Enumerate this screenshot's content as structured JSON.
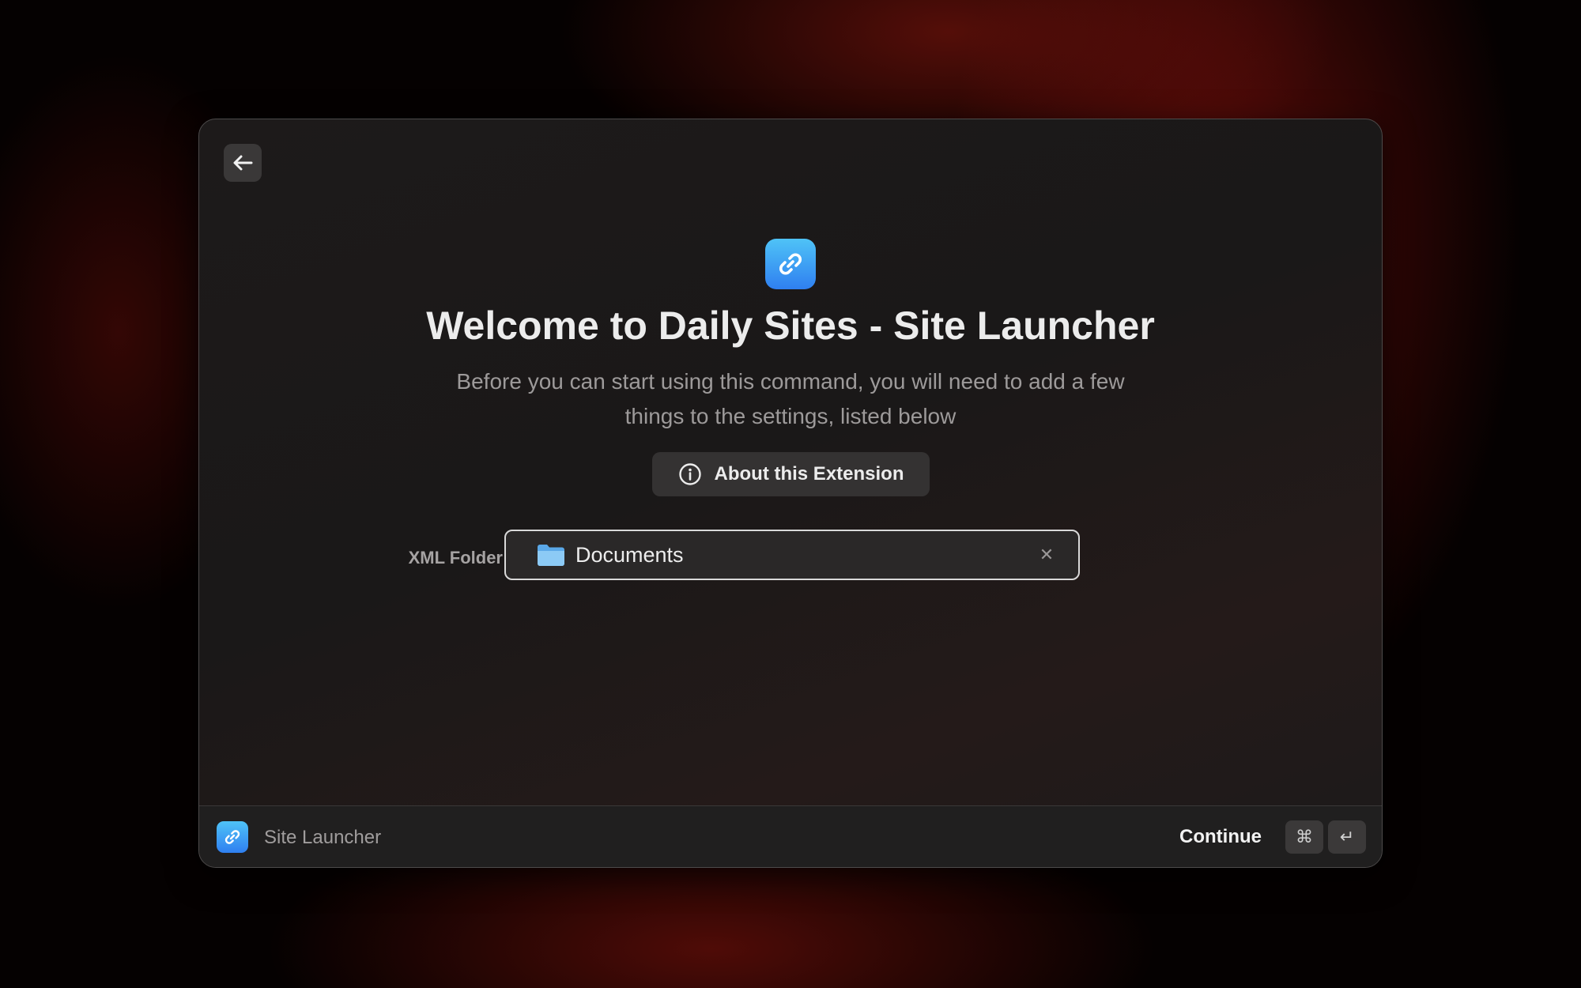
{
  "window": {
    "title": "Welcome to Daily Sites - Site Launcher",
    "subtitle_line1": "Before you can start using this command, you will need to add a few",
    "subtitle_line2": "things to the settings, listed below",
    "app_icon": "link-icon"
  },
  "toolbar": {
    "back_icon": "arrow-left-icon"
  },
  "about_button": {
    "label": "About this Extension",
    "icon": "info-circle-icon"
  },
  "form": {
    "xml_folder_label": "XML Folder",
    "xml_folder_value": "Documents",
    "folder_icon": "folder-icon",
    "clear_icon": "close-icon",
    "clear_glyph": "✕"
  },
  "footer": {
    "extension_name": "Site Launcher",
    "primary_action": "Continue",
    "shortcut_keys": [
      "⌘",
      "↵"
    ]
  },
  "colors": {
    "accent_gradient_top": "#4fc3f7",
    "accent_gradient_bottom": "#2f7ff0",
    "window_background": "#1c1a1a",
    "wallpaper_accent": "#a0140f"
  }
}
